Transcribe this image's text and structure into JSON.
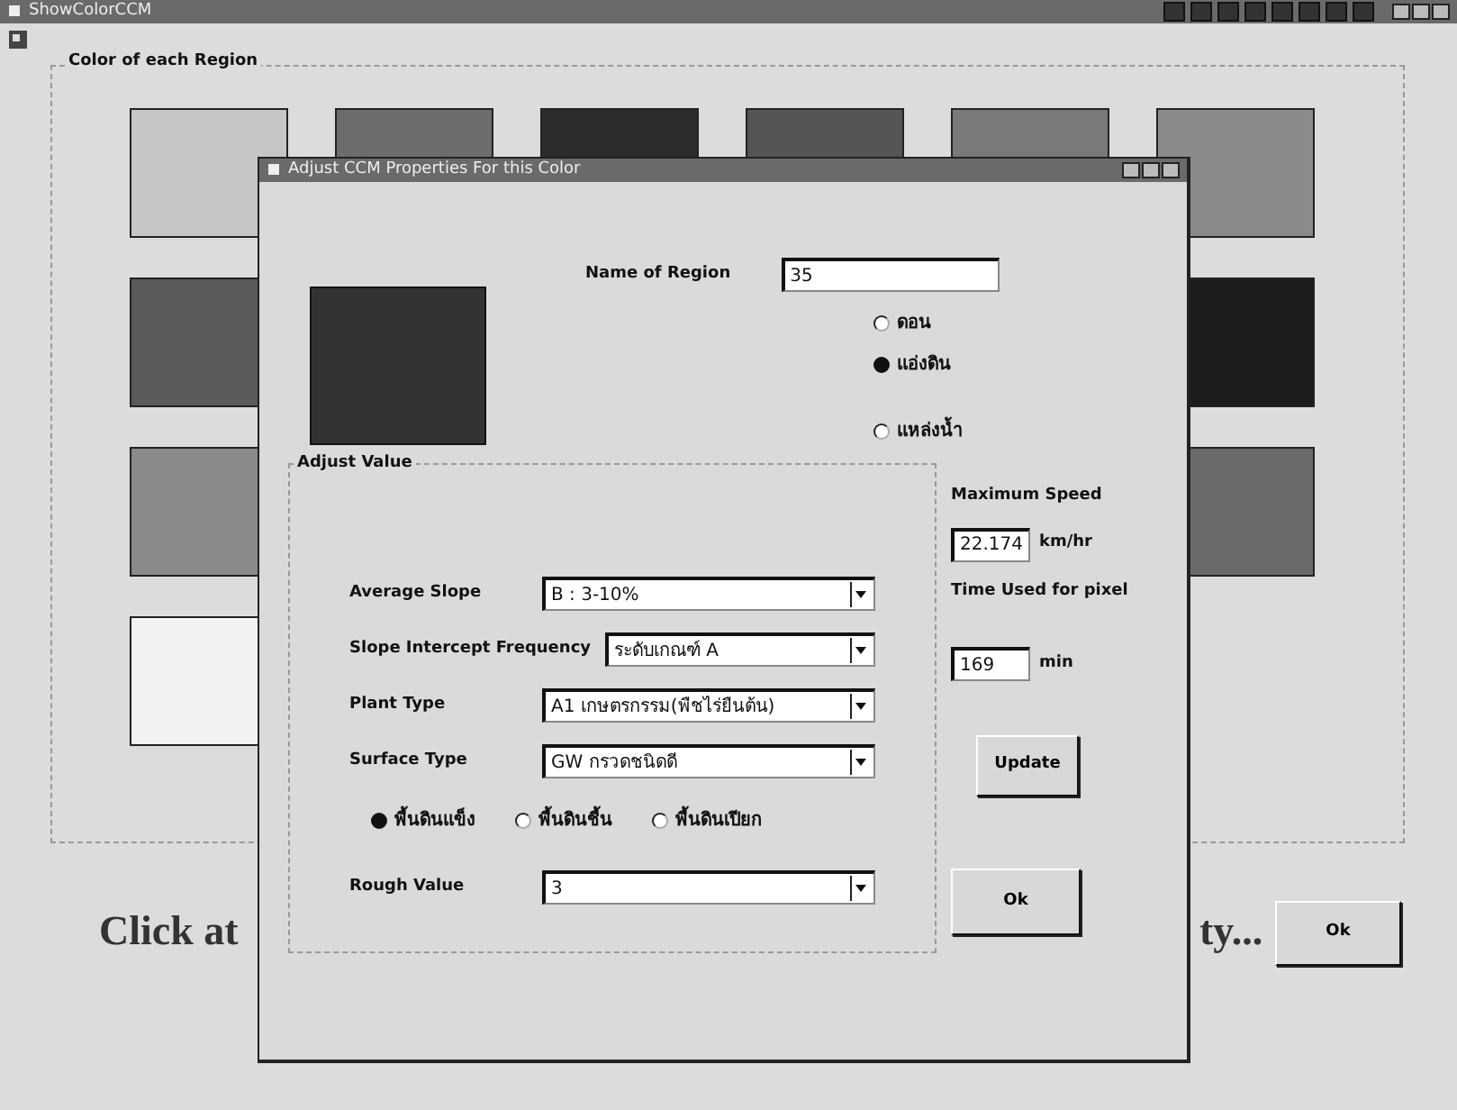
{
  "main_window": {
    "title": "ShowColorCCM",
    "group_title": "Color of each Region",
    "swatch_rows": [
      {
        "cells": [
          {
            "color": "#c6c6c6"
          },
          {
            "color": "#6c6c6c"
          },
          {
            "color": "#2c2c2c"
          },
          {
            "color": "#555555"
          },
          {
            "color": "#7a7a7a"
          },
          {
            "color": "#8a8a8a"
          }
        ]
      },
      {
        "cells": [
          {
            "color": "#5a5a5a"
          },
          {
            "color": "#1c1c1c"
          }
        ]
      },
      {
        "cells": [
          {
            "color": "#8a8a8a"
          },
          {
            "color": "#6a6a6a"
          }
        ]
      },
      {
        "cells": [
          {
            "color": "#f2f2f2"
          }
        ]
      }
    ],
    "prompt_left": "Click at",
    "prompt_right": "ty...",
    "ok_button": "Ok"
  },
  "dialog": {
    "title": "Adjust CCM Properties For this Color",
    "swatch": {
      "color": "#333333"
    },
    "name_label": "Name of Region",
    "name_value": "35",
    "terrain_options": [
      {
        "label": "ดอน",
        "selected": false
      },
      {
        "label": "แอ่งดิน",
        "selected": true
      },
      {
        "label": "แหล่งน้ำ",
        "selected": false
      }
    ],
    "adjust_group": "Adjust Value",
    "fields": [
      {
        "label": "Average Slope",
        "value": "B : 3-10%"
      },
      {
        "label": "Slope Intercept Frequency",
        "value": "ระดับเกณฑ์ A"
      },
      {
        "label": "Plant Type",
        "value": "A1 เกษตรกรรม(พืชไร่ยืนต้น)"
      },
      {
        "label": "Surface Type",
        "value": "GW กรวดชนิดดี"
      }
    ],
    "ground_options": [
      {
        "label": "พื้นดินแข็ง",
        "selected": true
      },
      {
        "label": "พื้นดินชื้น",
        "selected": false
      },
      {
        "label": "พื้นดินเปียก",
        "selected": false
      }
    ],
    "rough": {
      "label": "Rough Value",
      "value": "3"
    },
    "speed_label": "Maximum Speed",
    "speed_value": "22.174",
    "speed_unit": "km/hr",
    "time_label": "Time Used for pixel",
    "time_value": "169",
    "time_unit": "min",
    "update_button": "Update",
    "ok_button": "Ok"
  }
}
